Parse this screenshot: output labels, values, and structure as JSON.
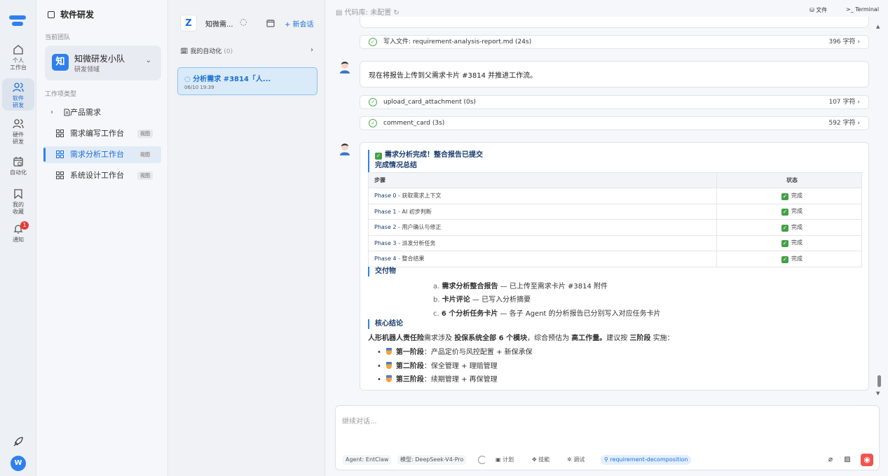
{
  "rail": {
    "items": [
      {
        "label": "个人\n工作台"
      },
      {
        "label": "软件\n研发"
      },
      {
        "label": "硬件\n研发"
      },
      {
        "label": "自动化"
      },
      {
        "label": "我的\n收藏"
      },
      {
        "label": "通知"
      }
    ],
    "badge": "1",
    "avatar": "W"
  },
  "sidebar": {
    "title": "软件研发",
    "team_label": "当前团队",
    "team_logo": "知",
    "team_name": "知微研发小队",
    "team_sub": "研发领域",
    "types_label": "工作项类型",
    "items": [
      {
        "label": "产品需求",
        "tag": ""
      },
      {
        "label": "需求编写工作台",
        "tag": "视图"
      },
      {
        "label": "需求分析工作台",
        "tag": "视图"
      },
      {
        "label": "系统设计工作台",
        "tag": "视图"
      }
    ]
  },
  "conversations": {
    "logo": "Z",
    "name": "知微需...",
    "new_label": "+ 新会话",
    "automation_label": "我的自动化",
    "automation_count": "(0)",
    "session": {
      "title": "分析需求 #3814「人...",
      "time": "06/10 19:39"
    }
  },
  "main": {
    "repo": "代码库: 未配置",
    "files": "文件",
    "terminal": "Terminal",
    "tool1": {
      "name": "写入文件: requirement-analysis-report.md (24s)",
      "size": "396 字符"
    },
    "message": "现在将报告上传到父需求卡片 #3814 并推进工作流。",
    "tool2": {
      "name": "upload_card_attachment (0s)",
      "size": "107 字符"
    },
    "tool3": {
      "name": "comment_card (3s)",
      "size": "592 字符"
    },
    "report": {
      "title": "需求分析完成！整合报告已提交",
      "summary_heading": "完成情况总结",
      "col_step": "步骤",
      "col_status": "状态",
      "rows": [
        {
          "phase": "Phase 0",
          "desc": " - 获取需求上下文",
          "status": "完成"
        },
        {
          "phase": "Phase 1",
          "desc": " - AI 初步判断",
          "status": "完成"
        },
        {
          "phase": "Phase 2",
          "desc": " - 用户确认与修正",
          "status": "完成"
        },
        {
          "phase": "Phase 3",
          "desc": " - 派发分析任务",
          "status": "完成"
        },
        {
          "phase": "Phase 4",
          "desc": " - 整合结果",
          "status": "完成"
        }
      ],
      "deliverables_heading": "交付物",
      "deliverables": [
        {
          "idx": "a.",
          "bold": "需求分析整合报告",
          "text": " — 已上传至需求卡片 #3814 附件"
        },
        {
          "idx": "b.",
          "bold": "卡片评论",
          "text": " — 已写入分析摘要"
        },
        {
          "idx": "c.",
          "bold": "6 个分析任务卡片",
          "text": " — 各子 Agent 的分析报告已分别写入对应任务卡片"
        }
      ],
      "conclusion_heading": "核心结论",
      "conclusion": {
        "p1_bold": "人形机器人责任险",
        "p2": "需求涉及 ",
        "p3_bold": "投保系统全部 6 个模块",
        "p4": "，综合预估为 ",
        "p5_bold": "高工作量。",
        "p6": "建议按 ",
        "p7_bold": "三阶段",
        "p8": " 实施："
      },
      "stages": [
        {
          "bold": "第一阶段",
          "text": "：产品定价与风控配置 + 新保承保"
        },
        {
          "bold": "第二阶段",
          "text": "：保全管理 + 理赔管理"
        },
        {
          "bold": "第三阶段",
          "text": "：续期管理 + 再保管理"
        }
      ]
    }
  },
  "input": {
    "placeholder": "继续对话...",
    "agent": "Agent: EntClaw",
    "model": "模型: DeepSeek-V4-Pro",
    "plan": "计划",
    "skill": "技能",
    "debug": "调试",
    "skill_tag": "requirement-decomposition"
  },
  "colors": {
    "accent": "#2f80ed",
    "success": "#43a047",
    "danger": "#ef5350"
  }
}
